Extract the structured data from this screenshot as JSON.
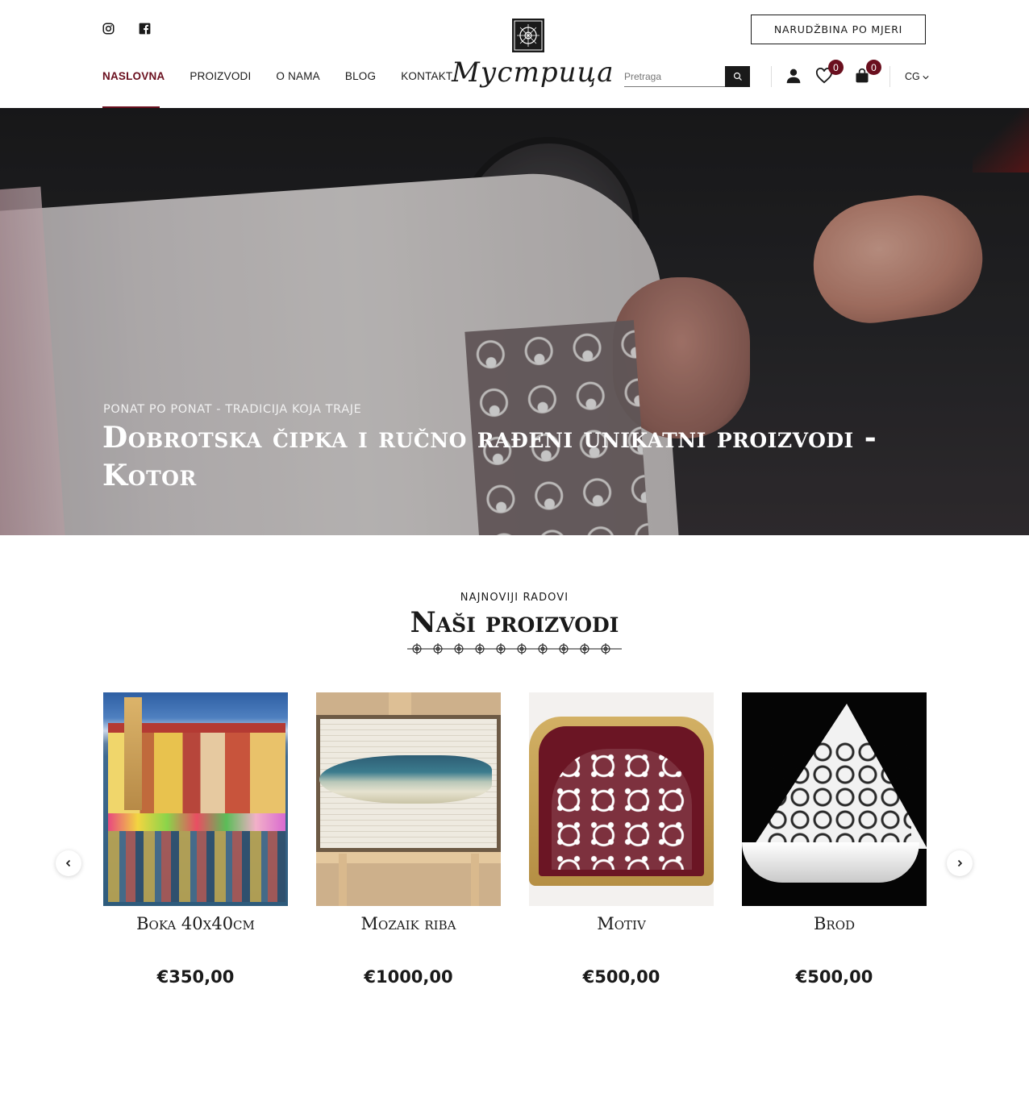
{
  "header": {
    "social": {
      "instagram_icon": "instagram-icon",
      "facebook_icon": "facebook-icon"
    },
    "order_button": "NARUDŽBINA PO MJERI",
    "logo_text": "Мустрица",
    "nav": [
      {
        "label": "NASLOVNA",
        "active": true
      },
      {
        "label": "PROIZVODI",
        "active": false
      },
      {
        "label": "O NAMA",
        "active": false
      },
      {
        "label": "BLOG",
        "active": false
      },
      {
        "label": "KONTAKT",
        "active": false
      }
    ],
    "search": {
      "placeholder": "Pretraga"
    },
    "wishlist_count": "0",
    "cart_count": "0",
    "language": "CG"
  },
  "hero": {
    "subtitle": "PONAT PO PONAT - TRADICIJA KOJA TRAJE",
    "title": "Dobrotska čipka i ručno rađeni unikatni proizvodi - Kotor"
  },
  "products_section": {
    "kicker": "NAJNOVIJI RADOVI",
    "title": "Naši proizvodi",
    "products": [
      {
        "name": "Boka 40x40cm",
        "price": "€350,00"
      },
      {
        "name": "Mozaik riba",
        "price": "€1000,00"
      },
      {
        "name": "Motiv",
        "price": "€500,00"
      },
      {
        "name": "Brod",
        "price": "€500,00"
      }
    ]
  },
  "colors": {
    "accent": "#6a0f1e",
    "text": "#1a1a1a",
    "background": "#ffffff"
  }
}
